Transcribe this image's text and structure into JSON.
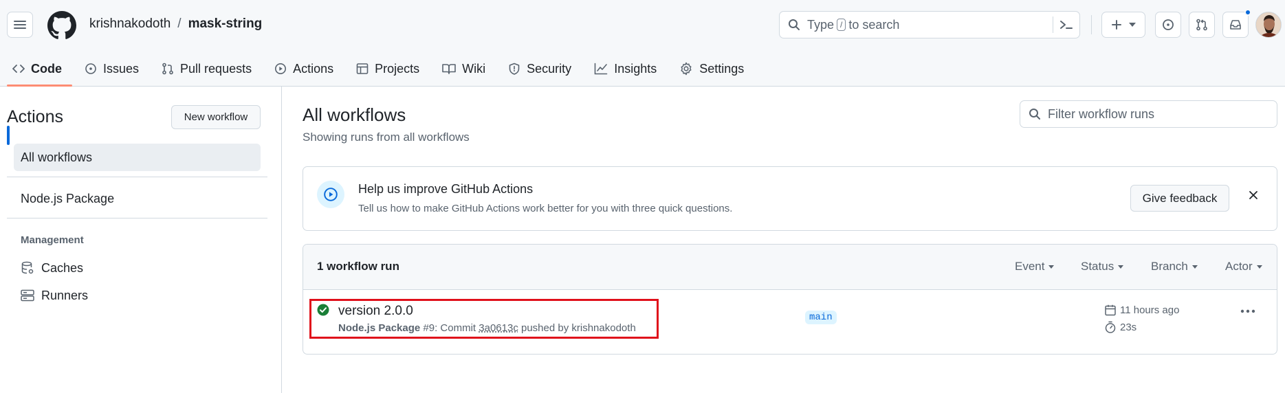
{
  "header": {
    "owner": "krishnakodoth",
    "separator": "/",
    "repo": "mask-string",
    "search_pre": "Type",
    "search_key": "/",
    "search_post": "to search",
    "notification_dot_color": "#0969da"
  },
  "tabs": [
    {
      "label": "Code",
      "icon": "code-icon",
      "selected": true
    },
    {
      "label": "Issues",
      "icon": "issue-opened-icon"
    },
    {
      "label": "Pull requests",
      "icon": "git-pull-request-icon"
    },
    {
      "label": "Actions",
      "icon": "play-icon"
    },
    {
      "label": "Projects",
      "icon": "table-icon"
    },
    {
      "label": "Wiki",
      "icon": "book-icon"
    },
    {
      "label": "Security",
      "icon": "shield-icon"
    },
    {
      "label": "Insights",
      "icon": "graph-icon"
    },
    {
      "label": "Settings",
      "icon": "gear-icon"
    }
  ],
  "sidebar": {
    "title": "Actions",
    "new_workflow": "New workflow",
    "all_workflows": "All workflows",
    "workflow": "Node.js Package",
    "management_heading": "Management",
    "caches": "Caches",
    "runners": "Runners"
  },
  "main": {
    "title": "All workflows",
    "subtitle": "Showing runs from all workflows",
    "filter_placeholder": "Filter workflow runs"
  },
  "banner": {
    "title": "Help us improve GitHub Actions",
    "description": "Tell us how to make GitHub Actions work better for you with three quick questions.",
    "feedback_button": "Give feedback"
  },
  "runs": {
    "count_label": "1 workflow run",
    "filters": {
      "event": "Event",
      "status": "Status",
      "branch": "Branch",
      "actor": "Actor"
    },
    "items": [
      {
        "title": "version 2.0.0",
        "workflow": "Node.js Package",
        "number": "#9: Commit",
        "commit": "3a0613c",
        "pushed_by": "pushed by krishnakodoth",
        "branch": "main",
        "time_ago": "11 hours ago",
        "duration": "23s",
        "status_color": "#1a7f37"
      }
    ],
    "highlight_color": "#e0101b"
  }
}
